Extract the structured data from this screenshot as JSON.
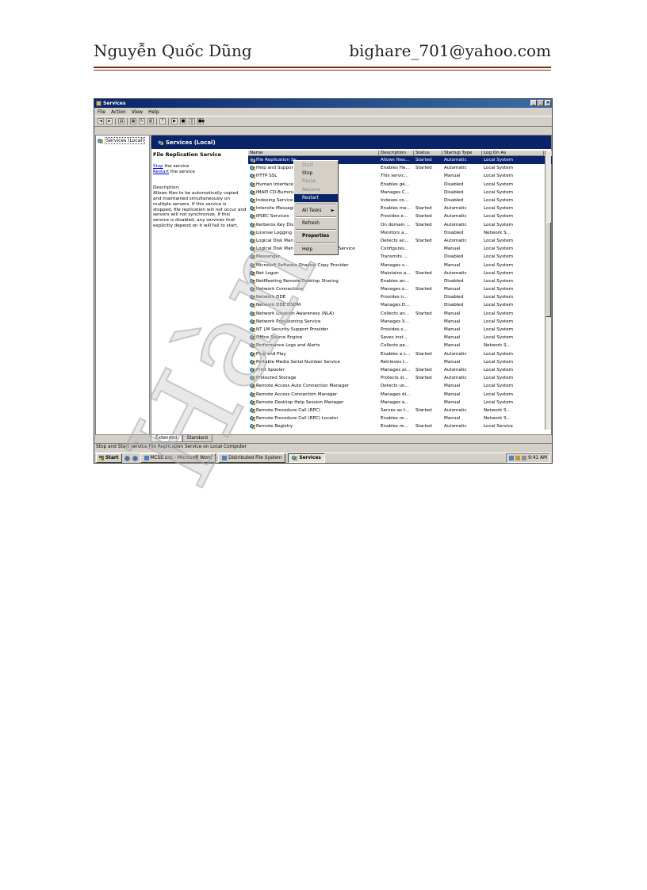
{
  "header": {
    "author": "Nguyễn Quốc Dũng",
    "email": "bighare_701@yahoo.com"
  },
  "watermark": "Hàn",
  "window": {
    "title": "Services",
    "menu": [
      "File",
      "Action",
      "View",
      "Help"
    ],
    "tree_root": "Services (Local)",
    "panel_title": "Services (Local)",
    "description_panel": {
      "service_name": "File Replication Service",
      "stop_link": "Stop",
      "stop_suffix": " the service",
      "restart_link": "Restart",
      "restart_suffix": " the service",
      "description_label": "Description:",
      "description_text": "Allows files to be automatically copied and maintained simultaneously on multiple servers. If this service is stopped, file replication will not occur and servers will not synchronize. If this service is disabled, any services that explicitly depend on it will fail to start."
    },
    "columns": [
      "Name",
      "Description",
      "Status",
      "Startup Type",
      "Log On As"
    ],
    "rows": [
      {
        "name": "File Replication Se",
        "description": "Allows files...",
        "status": "Started",
        "startup": "Automatic",
        "logon": "Local System"
      },
      {
        "name": "Help and Support",
        "description": "Enables He...",
        "status": "Started",
        "startup": "Automatic",
        "logon": "Local System"
      },
      {
        "name": "HTTP SSL",
        "description": "This servic...",
        "status": "",
        "startup": "Manual",
        "logon": "Local System"
      },
      {
        "name": "Human Interface",
        "description": "Enables ge...",
        "status": "",
        "startup": "Disabled",
        "logon": "Local System"
      },
      {
        "name": "IMAPI CD-Burning",
        "description": "Manages C...",
        "status": "",
        "startup": "Disabled",
        "logon": "Local System"
      },
      {
        "name": "Indexing Service",
        "description": "Indexes co...",
        "status": "",
        "startup": "Disabled",
        "logon": "Local System"
      },
      {
        "name": "Intersite Messagi",
        "description": "Enables me...",
        "status": "Started",
        "startup": "Automatic",
        "logon": "Local System"
      },
      {
        "name": "IPSEC Services",
        "description": "Provides e...",
        "status": "Started",
        "startup": "Automatic",
        "logon": "Local System"
      },
      {
        "name": "Kerberos Key Dist",
        "description": "On domain ...",
        "status": "Started",
        "startup": "Automatic",
        "logon": "Local System"
      },
      {
        "name": "License Logging",
        "description": "Monitors a...",
        "status": "",
        "startup": "Disabled",
        "logon": "Network S..."
      },
      {
        "name": "Logical Disk Mana",
        "description": "Detects an...",
        "status": "Started",
        "startup": "Automatic",
        "logon": "Local System"
      },
      {
        "name": "Logical Disk Manager Administrative Service",
        "description": "Configures...",
        "status": "",
        "startup": "Manual",
        "logon": "Local System"
      },
      {
        "name": "Messenger",
        "description": "Transmits ...",
        "status": "",
        "startup": "Disabled",
        "logon": "Local System"
      },
      {
        "name": "Microsoft Software Shadow Copy Provider",
        "description": "Manages s...",
        "status": "",
        "startup": "Manual",
        "logon": "Local System"
      },
      {
        "name": "Net Logon",
        "description": "Maintains a...",
        "status": "Started",
        "startup": "Automatic",
        "logon": "Local System"
      },
      {
        "name": "NetMeeting Remote Desktop Sharing",
        "description": "Enables an...",
        "status": "",
        "startup": "Disabled",
        "logon": "Local System"
      },
      {
        "name": "Network Connections",
        "description": "Manages o...",
        "status": "Started",
        "startup": "Manual",
        "logon": "Local System"
      },
      {
        "name": "Network DDE",
        "description": "Provides n...",
        "status": "",
        "startup": "Disabled",
        "logon": "Local System"
      },
      {
        "name": "Network DDE DSDM",
        "description": "Manages D...",
        "status": "",
        "startup": "Disabled",
        "logon": "Local System"
      },
      {
        "name": "Network Location Awareness (NLA)",
        "description": "Collects an...",
        "status": "Started",
        "startup": "Manual",
        "logon": "Local System"
      },
      {
        "name": "Network Provisioning Service",
        "description": "Manages X...",
        "status": "",
        "startup": "Manual",
        "logon": "Local System"
      },
      {
        "name": "NT LM Security Support Provider",
        "description": "Provides s...",
        "status": "",
        "startup": "Manual",
        "logon": "Local System"
      },
      {
        "name": "Office Source Engine",
        "description": "Saves inst...",
        "status": "",
        "startup": "Manual",
        "logon": "Local System"
      },
      {
        "name": "Performance Logs and Alerts",
        "description": "Collects pe...",
        "status": "",
        "startup": "Manual",
        "logon": "Network S..."
      },
      {
        "name": "Plug and Play",
        "description": "Enables a c...",
        "status": "Started",
        "startup": "Automatic",
        "logon": "Local System"
      },
      {
        "name": "Portable Media Serial Number Service",
        "description": "Retrieves t...",
        "status": "",
        "startup": "Manual",
        "logon": "Local System"
      },
      {
        "name": "Print Spooler",
        "description": "Manages al...",
        "status": "Started",
        "startup": "Automatic",
        "logon": "Local System"
      },
      {
        "name": "Protected Storage",
        "description": "Protects st...",
        "status": "Started",
        "startup": "Automatic",
        "logon": "Local System"
      },
      {
        "name": "Remote Access Auto Connection Manager",
        "description": "Detects un...",
        "status": "",
        "startup": "Manual",
        "logon": "Local System"
      },
      {
        "name": "Remote Access Connection Manager",
        "description": "Manages di...",
        "status": "",
        "startup": "Manual",
        "logon": "Local System"
      },
      {
        "name": "Remote Desktop Help Session Manager",
        "description": "Manages a...",
        "status": "",
        "startup": "Manual",
        "logon": "Local System"
      },
      {
        "name": "Remote Procedure Call (RPC)",
        "description": "Serves as t...",
        "status": "Started",
        "startup": "Automatic",
        "logon": "Network S..."
      },
      {
        "name": "Remote Procedure Call (RPC) Locator",
        "description": "Enables re...",
        "status": "",
        "startup": "Manual",
        "logon": "Network S..."
      },
      {
        "name": "Remote Registry",
        "description": "Enables re...",
        "status": "Started",
        "startup": "Automatic",
        "logon": "Local Service"
      }
    ],
    "context_menu": {
      "start": "Start",
      "stop": "Stop",
      "pause": "Pause",
      "resume": "Resume",
      "restart": "Restart",
      "all_tasks": "All Tasks",
      "refresh": "Refresh",
      "properties": "Properties",
      "help": "Help"
    },
    "tabs": [
      "Extended",
      "Standard"
    ],
    "status_text": "Stop and Start service File Replication Service on Local Computer",
    "taskbar": {
      "start": "Start",
      "tasks": [
        "MCSE.doc - Microsoft Word",
        "Distributed File System",
        "Services"
      ],
      "clock": "9:41 AM"
    }
  }
}
